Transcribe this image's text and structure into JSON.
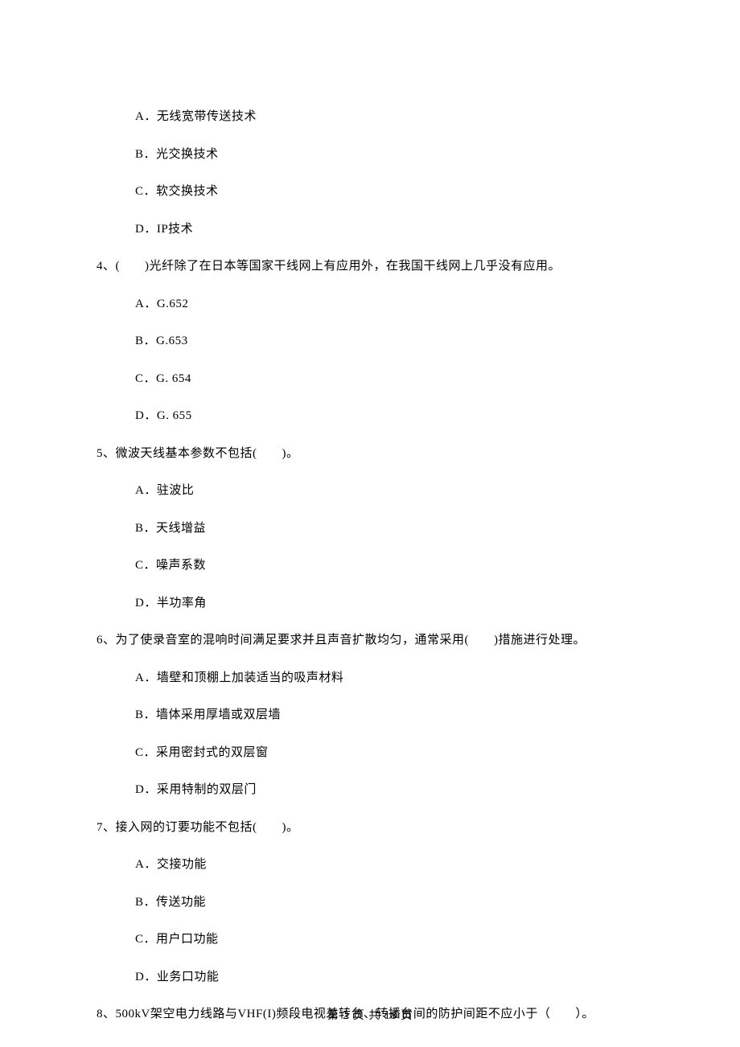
{
  "q3_options": {
    "a": "A．无线宽带传送技术",
    "b": "B．光交换技术",
    "c": "C．软交换技术",
    "d": "D．IP技术"
  },
  "q4": {
    "stem": "4、(　　)光纤除了在日本等国家干线网上有应用外，在我国干线网上几乎没有应用。",
    "a": "A．G.652",
    "b": "B．G.653",
    "c": "C．G. 654",
    "d": "D．G. 655"
  },
  "q5": {
    "stem": "5、微波天线基本参数不包括(　　)。",
    "a": "A．驻波比",
    "b": "B．天线增益",
    "c": "C．噪声系数",
    "d": "D．半功率角"
  },
  "q6": {
    "stem": "6、为了使录音室的混响时间满足要求并且声音扩散均匀，通常采用(　　)措施进行处理。",
    "a": "A．墙壁和顶棚上加装适当的吸声材料",
    "b": "B．墙体采用厚墙或双层墙",
    "c": "C．采用密封式的双层窗",
    "d": "D．采用特制的双层门"
  },
  "q7": {
    "stem": "7、接入网的订要功能不包括(　　)。",
    "a": "A．交接功能",
    "b": "B．传送功能",
    "c": "C．用户口功能",
    "d": "D．业务口功能"
  },
  "q8": {
    "stem": "8、500kV架空电力线路与VHF(I)频段电视差转台、转播台间的防护间距不应小于（　　）。"
  },
  "footer": "第 2 页 共 18 页"
}
